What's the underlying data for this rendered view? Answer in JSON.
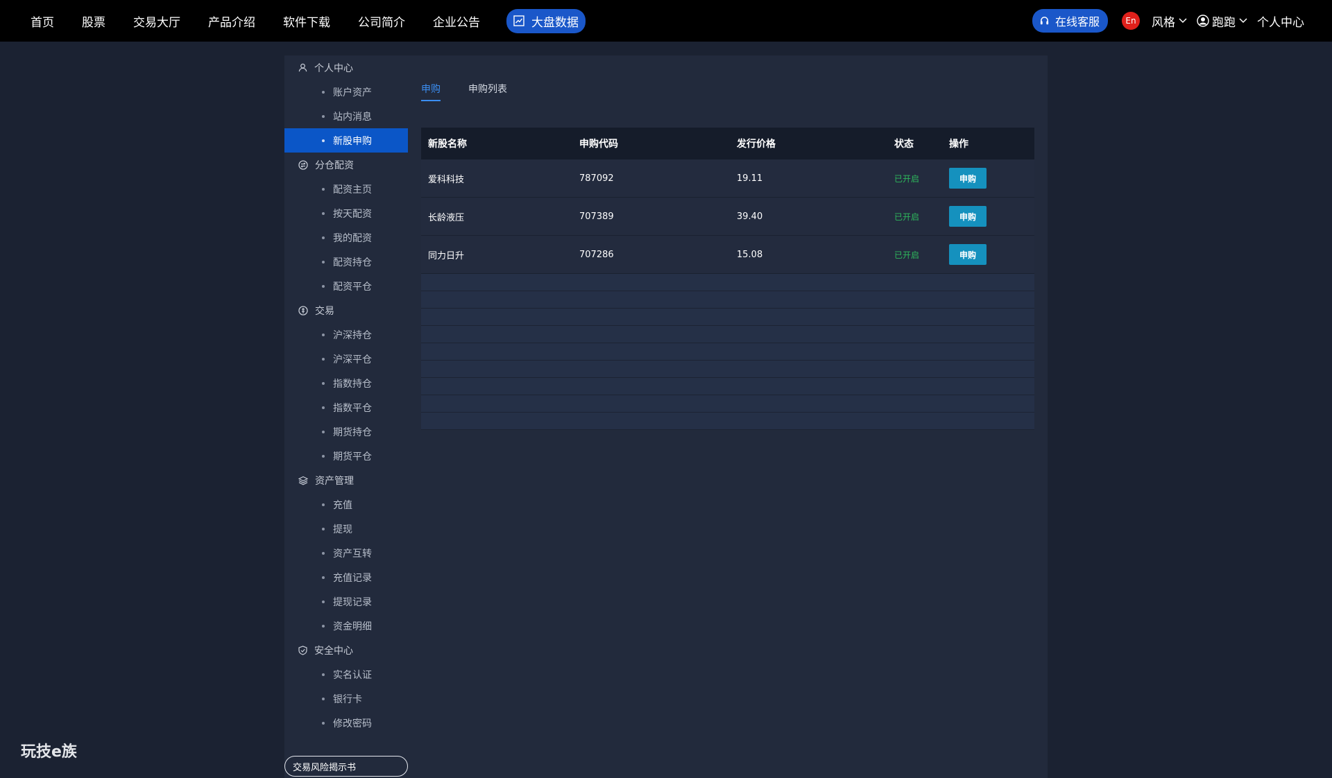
{
  "nav": {
    "items": [
      "首页",
      "股票",
      "交易大厅",
      "产品介绍",
      "软件下载",
      "公司简介",
      "企业公告"
    ],
    "highlight": "大盘数据"
  },
  "topright": {
    "service": "在线客服",
    "lang": "En",
    "style": "风格",
    "user": "跑跑",
    "personal": "个人中心"
  },
  "sidebar": {
    "personal": {
      "title": "个人中心",
      "items": [
        "账户资产",
        "站内消息",
        "新股申购"
      ]
    },
    "margin": {
      "title": "分仓配资",
      "items": [
        "配资主页",
        "按天配资",
        "我的配资",
        "配资持仓",
        "配资平仓"
      ]
    },
    "trade": {
      "title": "交易",
      "items": [
        "沪深持仓",
        "沪深平仓",
        "指数持仓",
        "指数平仓",
        "期货持仓",
        "期货平仓"
      ]
    },
    "assets": {
      "title": "资产管理",
      "items": [
        "充值",
        "提现",
        "资产互转",
        "充值记录",
        "提现记录",
        "资金明细"
      ]
    },
    "security": {
      "title": "安全中心",
      "items": [
        "实名认证",
        "银行卡",
        "修改密码"
      ]
    },
    "active_item": "新股申购",
    "risk_button": "交易风险揭示书"
  },
  "tabs": [
    "申购",
    "申购列表"
  ],
  "table": {
    "headers": [
      "新股名称",
      "申购代码",
      "发行价格",
      "状态",
      "操作"
    ],
    "rows": [
      {
        "name": "爱科科技",
        "code": "787092",
        "price": "19.11",
        "status": "已开启",
        "action": "申购"
      },
      {
        "name": "长龄液压",
        "code": "707389",
        "price": "39.40",
        "status": "已开启",
        "action": "申购"
      },
      {
        "name": "同力日升",
        "code": "707286",
        "price": "15.08",
        "status": "已开启",
        "action": "申购"
      }
    ]
  },
  "brand": "玩技e族",
  "colors": {
    "accent": "#1a57c9",
    "active": "#0b56c7",
    "status_open": "#2eb85c",
    "button": "#1591be"
  }
}
